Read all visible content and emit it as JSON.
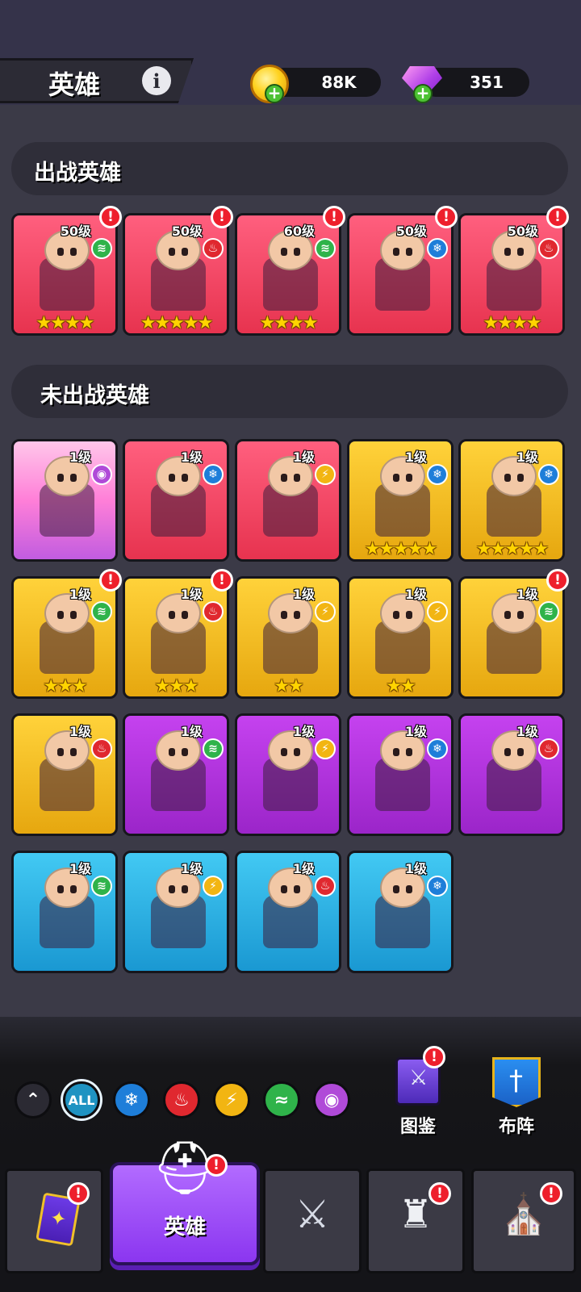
{
  "header": {
    "title": "英雄",
    "info_icon": "info-icon",
    "coins": {
      "value": "88K",
      "icon": "gold-coin-icon"
    },
    "gems": {
      "value": "351",
      "icon": "purple-gem-icon"
    }
  },
  "sections": {
    "active_title": "出战英雄",
    "inactive_title": "未出战英雄"
  },
  "active_heroes": [
    {
      "level": "50级",
      "element": "wind",
      "stars": "★★★★",
      "rarity": "red",
      "alert": true
    },
    {
      "level": "50级",
      "element": "fire",
      "stars": "★★★★★",
      "rarity": "red",
      "alert": true
    },
    {
      "level": "60级",
      "element": "wind",
      "stars": "★★★★",
      "rarity": "red",
      "alert": true
    },
    {
      "level": "50级",
      "element": "ice",
      "stars": "",
      "rarity": "red",
      "alert": true
    },
    {
      "level": "50级",
      "element": "fire",
      "stars": "★★★★",
      "rarity": "red",
      "alert": true
    }
  ],
  "inactive_heroes": [
    {
      "level": "1级",
      "element": "psy",
      "stars": "",
      "rarity": "pink",
      "alert": false
    },
    {
      "level": "1级",
      "element": "ice",
      "stars": "",
      "rarity": "red",
      "alert": false
    },
    {
      "level": "1级",
      "element": "thunder",
      "stars": "",
      "rarity": "red",
      "alert": false
    },
    {
      "level": "1级",
      "element": "ice",
      "stars": "★★★★★",
      "rarity": "gold",
      "alert": false
    },
    {
      "level": "1级",
      "element": "ice",
      "stars": "★★★★★",
      "rarity": "gold",
      "alert": false
    },
    {
      "level": "1级",
      "element": "wind",
      "stars": "★★★",
      "rarity": "gold",
      "alert": true
    },
    {
      "level": "1级",
      "element": "fire",
      "stars": "★★★",
      "rarity": "gold",
      "alert": true
    },
    {
      "level": "1级",
      "element": "thunder",
      "stars": "★★",
      "rarity": "gold",
      "alert": false
    },
    {
      "level": "1级",
      "element": "thunder",
      "stars": "★★",
      "rarity": "gold",
      "alert": false
    },
    {
      "level": "1级",
      "element": "wind",
      "stars": "",
      "rarity": "gold",
      "alert": true
    },
    {
      "level": "1级",
      "element": "fire",
      "stars": "",
      "rarity": "gold",
      "alert": false
    },
    {
      "level": "1级",
      "element": "wind",
      "stars": "",
      "rarity": "purple",
      "alert": false
    },
    {
      "level": "1级",
      "element": "thunder",
      "stars": "",
      "rarity": "purple",
      "alert": false
    },
    {
      "level": "1级",
      "element": "ice",
      "stars": "",
      "rarity": "purple",
      "alert": false
    },
    {
      "level": "1级",
      "element": "fire",
      "stars": "",
      "rarity": "purple",
      "alert": false
    },
    {
      "level": "1级",
      "element": "wind",
      "stars": "",
      "rarity": "blue",
      "alert": false
    },
    {
      "level": "1级",
      "element": "thunder",
      "stars": "",
      "rarity": "blue",
      "alert": false
    },
    {
      "level": "1级",
      "element": "fire",
      "stars": "",
      "rarity": "blue",
      "alert": false
    },
    {
      "level": "1级",
      "element": "ice",
      "stars": "",
      "rarity": "blue",
      "alert": false
    }
  ],
  "filters": {
    "collapse_icon": "double-chevron-up-icon",
    "all_label": "ALL",
    "ice_icon": "snowflake-icon",
    "fire_icon": "flame-icon",
    "thunder_icon": "lightning-icon",
    "wind_icon": "tornado-icon",
    "psy_icon": "eye-icon"
  },
  "side_buttons": {
    "codex_label": "图鉴",
    "formation_label": "布阵"
  },
  "nav": {
    "cards_icon": "card-icon",
    "heroes_label": "英雄",
    "battle_icon": "crossed-swords-icon",
    "castle_icon": "castle-icon",
    "shop_icon": "shop-icon"
  },
  "alert_glyph": "!",
  "colors": {
    "red_card": "#e7334f",
    "gold_card": "#e6a70f",
    "purple_card": "#9b25c9",
    "blue_card": "#1a98d2",
    "alert": "#ee1f2c",
    "active_tab": "#8b36f0"
  }
}
